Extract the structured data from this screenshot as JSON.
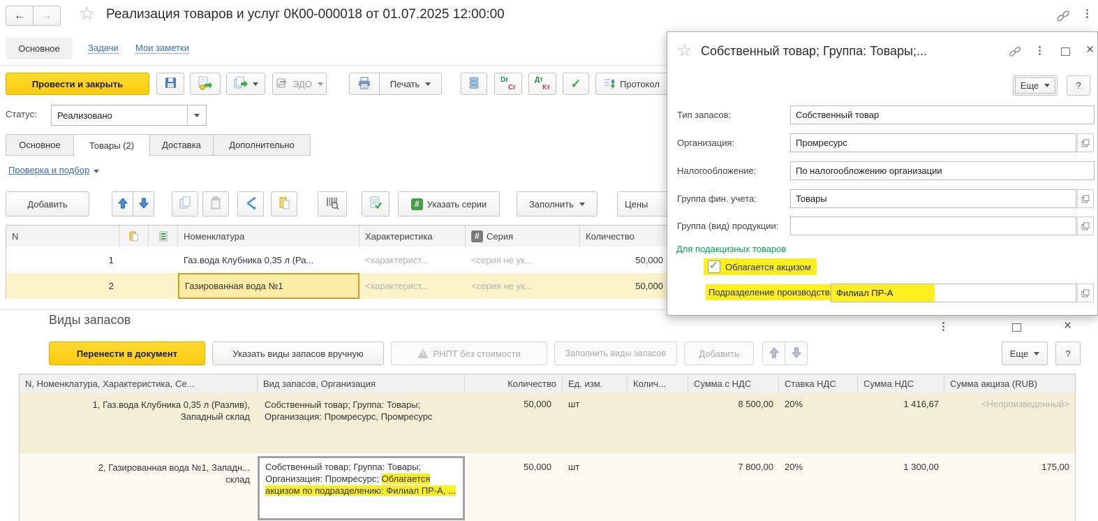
{
  "icons": {
    "star": "☆",
    "back": "←",
    "forward": "→",
    "close": "×",
    "check": "✓",
    "hash": "#",
    "warning": "!",
    "question": "?",
    "dr": "Dr",
    "cr": "Cr",
    "dt": "Дт",
    "kt": "Кт"
  },
  "window": {
    "title": "Реализация товаров и услуг 0К00-000018 от 01.07.2025 12:00:00"
  },
  "nav": {
    "tabs": [
      "Основное",
      "Задачи",
      "Мои заметки"
    ]
  },
  "toolbar": {
    "post_and_close": "Провести и закрыть",
    "edo": "ЭДО",
    "print": "Печать",
    "protocol": "Протокол"
  },
  "status": {
    "label": "Статус:",
    "value": "Реализовано"
  },
  "doc_tabs": [
    "Основное",
    "Товары (2)",
    "Доставка",
    "Дополнительно"
  ],
  "goods": {
    "check_link": "Проверка и подбор",
    "toolbar": {
      "add": "Добавить",
      "set_series": "Указать серии",
      "fill": "Заполнить",
      "prices": "Цены"
    },
    "table": {
      "headers": {
        "n": "N",
        "nomenclature": "Номенклатура",
        "characteristic": "Характеристика",
        "series": "Серия",
        "quantity": "Количество"
      },
      "rows": [
        {
          "n": "1",
          "nomenclature": "Газ.вода Клубника 0,35 л (Ра...",
          "characteristic": "<характерист...",
          "series": "<серия не ук...",
          "quantity": "50,000"
        },
        {
          "n": "2",
          "nomenclature": "Газированная вода №1",
          "characteristic": "<характерист...",
          "series": "<серия не ук...",
          "quantity": "50,000"
        }
      ]
    }
  },
  "dialog": {
    "title": "Собственный товар; Группа: Товары;...",
    "more": "Еще",
    "fields": [
      {
        "label": "Тип запасов:",
        "value": "Собственный товар"
      },
      {
        "label": "Организация:",
        "value": "Промресурс"
      },
      {
        "label": "Налогообложение:",
        "value": "По налогообложению организации"
      },
      {
        "label": "Группа фин. учета:",
        "value": "Товары"
      },
      {
        "label": "Группа (вид) продукции:",
        "value": ""
      }
    ],
    "excise_section": "Для подакцизных товаров",
    "excise_checkbox": "Облагается акцизом",
    "production_label": "Подразделение производства:",
    "production_value": "Филиал ПР-А"
  },
  "stock": {
    "title": "Виды запасов",
    "buttons": {
      "transfer": "Перенести в документ",
      "manual": "Указать виды запасов вручную",
      "rnpt": "РНПТ без стоимости",
      "fill": "Заполнить виды запасов",
      "add": "Добавить",
      "more": "Еще"
    },
    "table": {
      "headers": [
        "N, Номенклатура, Характеристика, Се...",
        "Вид запасов, Организация",
        "Количество",
        "Ед. изм.",
        "Колич...",
        "Сумма с НДС",
        "Ставка НДС",
        "Сумма НДС",
        "Сумма акциза (RUB)"
      ],
      "rows": [
        {
          "item": "1, Газ.вода Клубника 0,35 л (Разлив), Западный склад",
          "type": "Собственный товар; Группа: Товары; Организация: Промресурс, Промресурс",
          "type_highlight": "",
          "qty": "50,000",
          "unit": "шт",
          "qty2": "",
          "sum_vat": "8 500,00",
          "vat_rate": "20%",
          "vat_sum": "1 416,67",
          "excise": "<Непроизведенный>"
        },
        {
          "item": "2, Газированная вода №1, Западн... склад",
          "type": "Собственный товар; Группа: Товары; Организация: Промресурс;",
          "type_highlight": "Облагается акцизом по подразделению: Филиал ПР-А, ...",
          "qty": "50,000",
          "unit": "шт",
          "qty2": "",
          "sum_vat": "7 800,00",
          "vat_rate": "20%",
          "vat_sum": "1 300,00",
          "excise": "175,00"
        }
      ]
    }
  }
}
